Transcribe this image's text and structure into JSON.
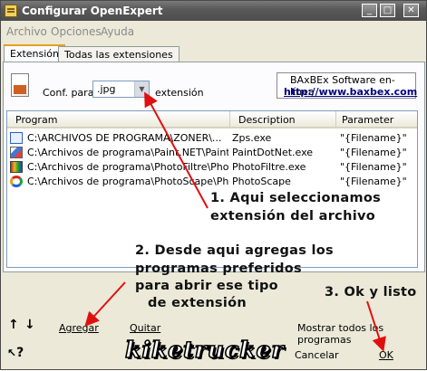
{
  "window": {
    "title": "Configurar OpenExpert",
    "controls": {
      "minimize": "_",
      "maximize": "□",
      "close": "✕"
    },
    "icon": "app-icon"
  },
  "menu": {
    "items": [
      "Archivo",
      "Opciones",
      "Ayuda"
    ]
  },
  "tabs": [
    {
      "label": "Extensión",
      "active": true
    },
    {
      "label": "Todas las extensiones",
      "active": false
    }
  ],
  "config": {
    "prefix_label": "Conf. para",
    "extension_value": ".jpg",
    "suffix_label": "extensión",
    "doc_icon": "document-icon"
  },
  "software": {
    "name": "BAxBEx Software en-línea",
    "url": "http://www.baxbex.com"
  },
  "table": {
    "columns": [
      "Program",
      "Description",
      "Parameter"
    ],
    "rows": [
      {
        "program": "C:\\ARCHIVOS DE PROGRAMA\\ZONER\\...",
        "description": "Zps.exe",
        "parameter": "\"{Filename}\"",
        "icon": "zoner-icon"
      },
      {
        "program": "C:\\Archivos de programa\\Paint.NET\\Paint...",
        "description": "PaintDotNet.exe",
        "parameter": "\"{Filename}\"",
        "icon": "paintnet-icon"
      },
      {
        "program": "C:\\Archivos de programa\\PhotoFiltre\\Photo...",
        "description": "PhotoFiltre.exe",
        "parameter": "\"{Filename}\"",
        "icon": "photofiltre-icon"
      },
      {
        "program": "C:\\Archivos de programa\\PhotoScape\\Photo...",
        "description": "PhotoScape",
        "parameter": "\"{Filename}\"",
        "icon": "photoscape-icon"
      }
    ]
  },
  "annotations": {
    "a1_line1": "1. Aqui seleccionamos",
    "a1_line2": "extensión del archivo",
    "a2_line1": "2. Desde aqui agregas los",
    "a2_line2": "programas preferidos",
    "a2_line3": "para abrir ese tipo",
    "a2_line4": "de extensión",
    "a3": "3. Ok y listo",
    "arrow_color": "#e01010"
  },
  "bottom": {
    "up_arrow": "↑",
    "down_arrow": "↓",
    "add_label": "Agregar",
    "remove_label": "Quitar",
    "show_all_label": "Mostrar todos los programas",
    "help_icon": "?",
    "logo_text": "kiketrucker",
    "cancel_label": "Cancelar",
    "ok_label": "OK"
  }
}
